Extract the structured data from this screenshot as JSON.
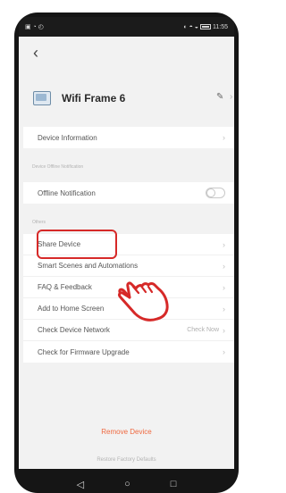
{
  "status_bar": {
    "left_icons": "▣ ◔ ◴",
    "right_icons": "◐ ◓ ◒",
    "time": "11:55"
  },
  "navigation": {
    "back_icon": "‹"
  },
  "device": {
    "name": "Wifi Frame 6",
    "edit_icon": "✎",
    "chevron": "›"
  },
  "sections": {
    "device_information": "Device Information",
    "device_offline_notification_caption": "Device Offline Notification",
    "offline_notification": "Offline Notification",
    "others_caption": "Others",
    "items": [
      "Share Device",
      "Smart Scenes and Automations",
      "FAQ & Feedback",
      "Add to Home Screen",
      "Check Device Network",
      "Check for Firmware Upgrade"
    ],
    "check_now_label": "Check Now"
  },
  "actions": {
    "remove_device": "Remove Device",
    "restore_factory_defaults": "Restore Factory Defaults"
  },
  "nav_buttons": {
    "back": "◁",
    "home": "○",
    "recent": "□"
  },
  "colors": {
    "highlight": "#d62928",
    "remove_device": "#ef6940"
  }
}
